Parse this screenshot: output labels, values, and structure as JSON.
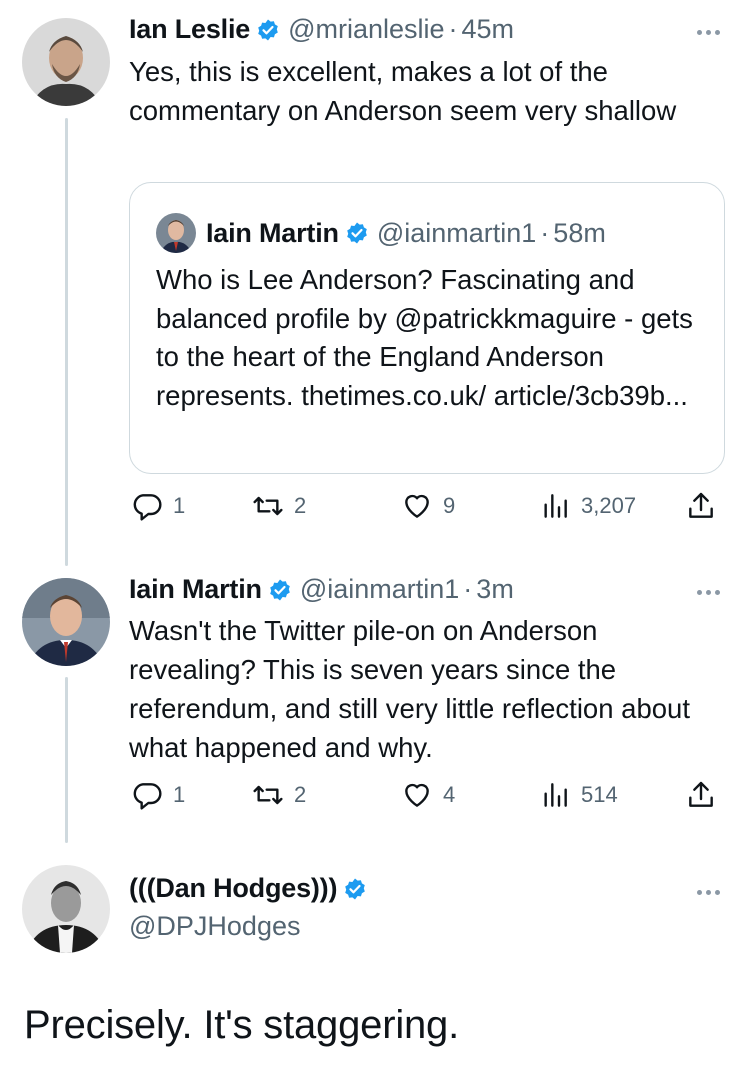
{
  "tweet1": {
    "name": "Ian Leslie",
    "handle": "@mrianleslie",
    "dot": "·",
    "time": "45m",
    "text": "Yes, this is excellent, makes a lot of the commentary on Anderson seem very shallow",
    "quote": {
      "name": "Iain Martin",
      "handle": "@iainmartin1",
      "dot": "·",
      "time": "58m",
      "text": "Who is Lee Anderson? Fascinating and balanced profile by @patrickkmaguire - gets to the heart of the England Anderson represents.  thetimes.co.uk/ article/3cb39b..."
    },
    "actions": {
      "replies": "1",
      "retweets": "2",
      "likes": "9",
      "views": "3,207"
    }
  },
  "tweet2": {
    "name": "Iain Martin",
    "handle": "@iainmartin1",
    "dot": "·",
    "time": "3m",
    "text": "Wasn't the Twitter pile-on on Anderson revealing? This is seven years since the referendum, and still very little reflection about what happened and why.",
    "actions": {
      "replies": "1",
      "retweets": "2",
      "likes": "4",
      "views": "514"
    }
  },
  "tweet3": {
    "name": "(((Dan Hodges)))",
    "handle": "@DPJHodges"
  },
  "caption": "Precisely. It's staggering.",
  "colors": {
    "verified": "#1d9bf0",
    "secondary": "#536471",
    "thread": "#cfd9de"
  },
  "icons": [
    "verified-icon",
    "more-icon",
    "reply-icon",
    "retweet-icon",
    "like-icon",
    "views-icon",
    "share-icon"
  ]
}
